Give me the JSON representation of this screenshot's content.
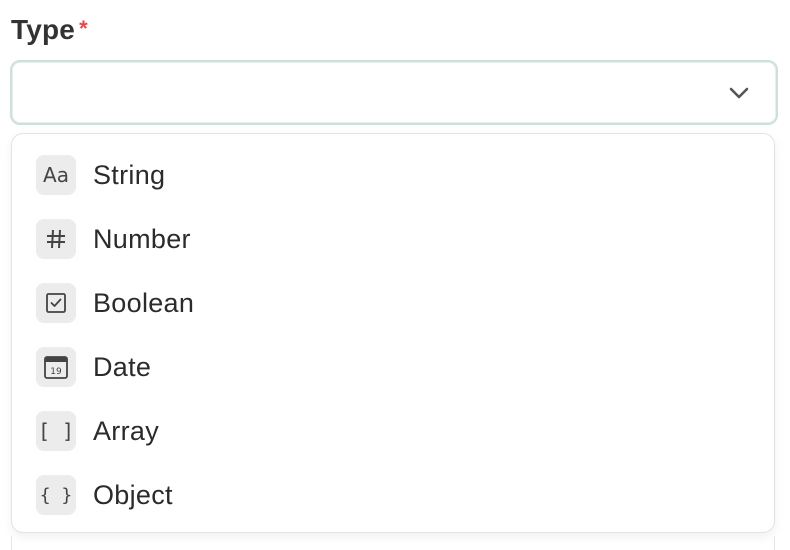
{
  "field": {
    "label": "Type",
    "required_mark": "*",
    "selected_value": ""
  },
  "options": [
    {
      "label": "String",
      "icon": "text-aa-icon",
      "glyph": "Aa"
    },
    {
      "label": "Number",
      "icon": "hash-icon",
      "glyph": "#"
    },
    {
      "label": "Boolean",
      "icon": "checkbox-icon",
      "glyph": ""
    },
    {
      "label": "Date",
      "icon": "calendar-icon",
      "glyph": "19"
    },
    {
      "label": "Array",
      "icon": "brackets-icon",
      "glyph": "[ ]"
    },
    {
      "label": "Object",
      "icon": "braces-icon",
      "glyph": "{ }"
    }
  ],
  "colors": {
    "required": "#e5484d",
    "select_border": "#cfe0db",
    "icon_bg": "#ececec",
    "text": "#2b2b2b"
  }
}
